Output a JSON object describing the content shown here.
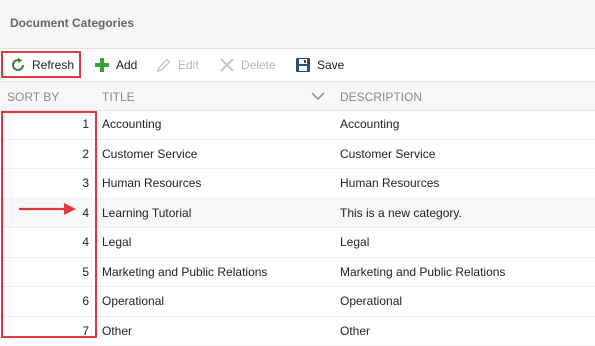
{
  "header": {
    "title": "Document Categories"
  },
  "toolbar": {
    "refresh_label": "Refresh",
    "add_label": "Add",
    "edit_label": "Edit",
    "delete_label": "Delete",
    "save_label": "Save"
  },
  "columns": {
    "sort_by": "SORT BY",
    "title": "TITLE",
    "description": "DESCRIPTION"
  },
  "rows": [
    {
      "sort": "1",
      "title": "Accounting",
      "description": "Accounting"
    },
    {
      "sort": "2",
      "title": "Customer Service",
      "description": "Customer Service"
    },
    {
      "sort": "3",
      "title": "Human Resources",
      "description": "Human Resources"
    },
    {
      "sort": "4",
      "title": "Learning Tutorial",
      "description": "This is a new category."
    },
    {
      "sort": "4",
      "title": "Legal",
      "description": "Legal"
    },
    {
      "sort": "5",
      "title": "Marketing and Public Relations",
      "description": "Marketing and Public Relations"
    },
    {
      "sort": "6",
      "title": "Operational",
      "description": "Operational"
    },
    {
      "sort": "7",
      "title": "Other",
      "description": "Other"
    }
  ],
  "colors": {
    "highlight": "#e0383e",
    "add_green": "#3aa335",
    "refresh_green": "#3f7d2f"
  },
  "icons": [
    "refresh-icon",
    "add-icon",
    "edit-icon",
    "delete-icon",
    "save-icon",
    "chevron-down-icon",
    "arrow-right-icon"
  ]
}
